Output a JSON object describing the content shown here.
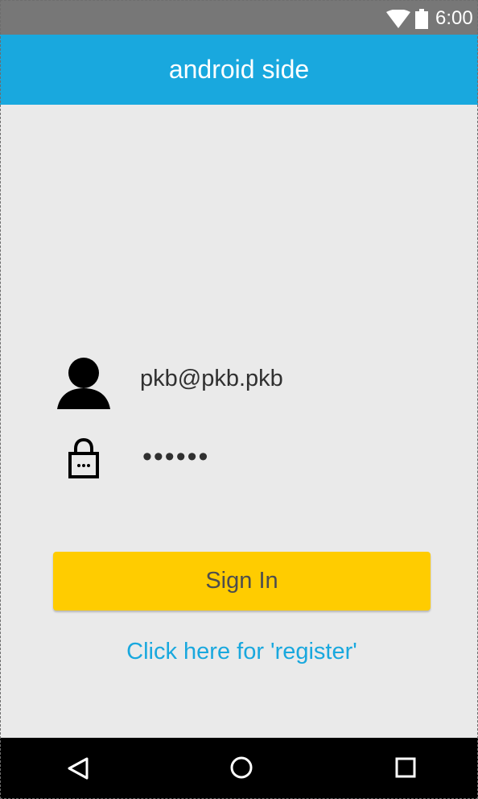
{
  "status_bar": {
    "time": "6:00",
    "icons": {
      "wifi": "wifi-icon",
      "battery": "battery-icon"
    }
  },
  "app_bar": {
    "title": "android side"
  },
  "login_form": {
    "email_value": "pkb@pkb.pkb",
    "password_value": "••••••",
    "user_icon": "user-icon",
    "lock_icon": "lock-icon"
  },
  "actions": {
    "sign_in_label": "Sign In",
    "register_label": "Click here for 'register'"
  },
  "navigation": {
    "back_icon": "back-icon",
    "home_icon": "home-icon",
    "recent_apps_icon": "recent-apps-icon"
  },
  "colors": {
    "status_bar": "#777777",
    "app_bar": "#19a8de",
    "background": "#eaeaea",
    "button": "#ffcc00",
    "link": "#19a8de",
    "navigation_bar": "#000000"
  }
}
